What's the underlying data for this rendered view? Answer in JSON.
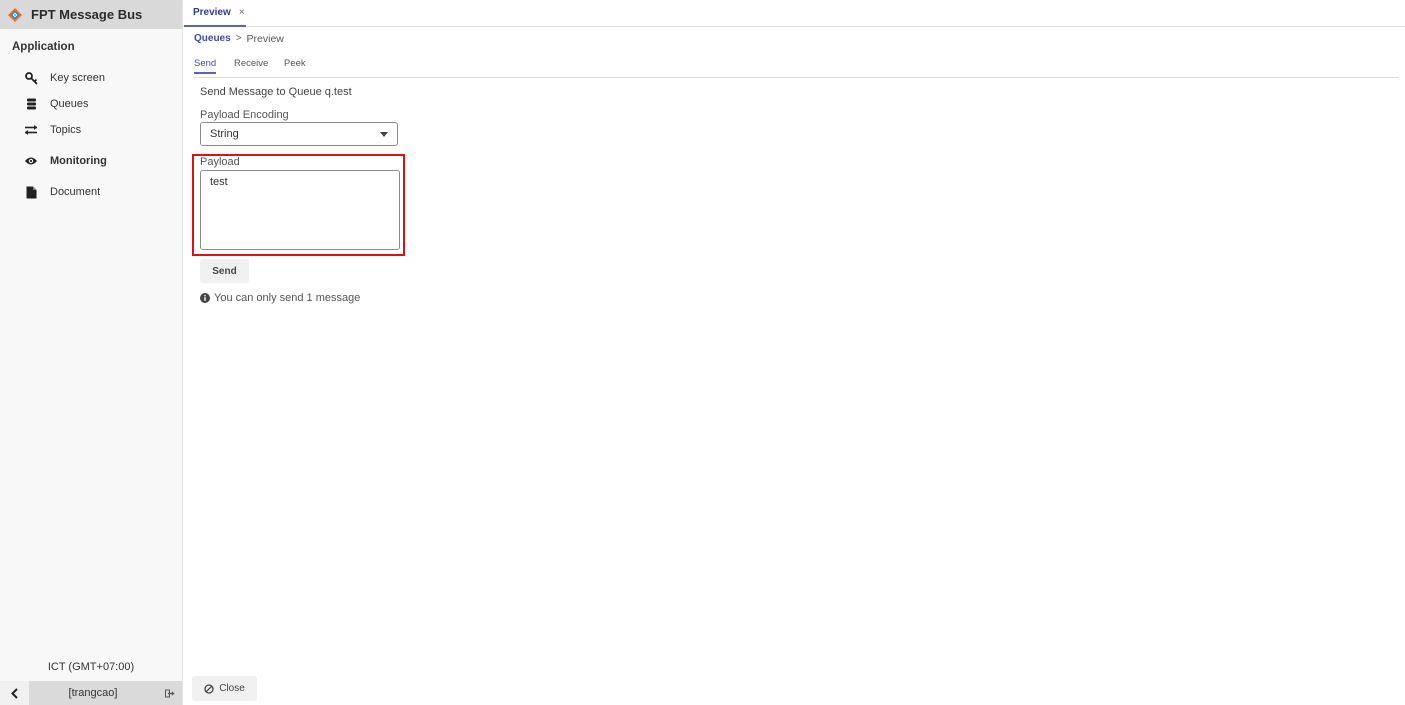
{
  "app": {
    "title": "FPT Message Bus",
    "logo_icon": "fpt-logo-icon"
  },
  "sidebar": {
    "section_title": "Application",
    "items": [
      {
        "label": "Key screen",
        "icon": "key-icon"
      },
      {
        "label": "Queues",
        "icon": "database-icon"
      },
      {
        "label": "Topics",
        "icon": "exchange-arrows-icon"
      },
      {
        "label": "Monitoring",
        "icon": "eye-icon"
      },
      {
        "label": "Document",
        "icon": "file-icon"
      }
    ],
    "timezone": "ICT (GMT+07:00)",
    "user": "[trangcao]"
  },
  "tabs": [
    {
      "label": "Preview",
      "close": "×"
    }
  ],
  "breadcrumb": {
    "parent": "Queues",
    "separator": ">",
    "current": "Preview"
  },
  "subtabs": [
    {
      "label": "Send",
      "active": true
    },
    {
      "label": "Receive",
      "active": false
    },
    {
      "label": "Peek",
      "active": false
    }
  ],
  "form": {
    "title": "Send Message to Queue q.test",
    "encoding_label": "Payload Encoding",
    "encoding_value": "String",
    "payload_label": "Payload",
    "payload_value": "test",
    "send_label": "Send",
    "info_text": "You can only send 1 message"
  },
  "footer": {
    "close_label": "Close"
  },
  "colors": {
    "accent": "#3f4aa8",
    "highlight": "#e01010",
    "brand_bar": "#d9d9d9"
  }
}
